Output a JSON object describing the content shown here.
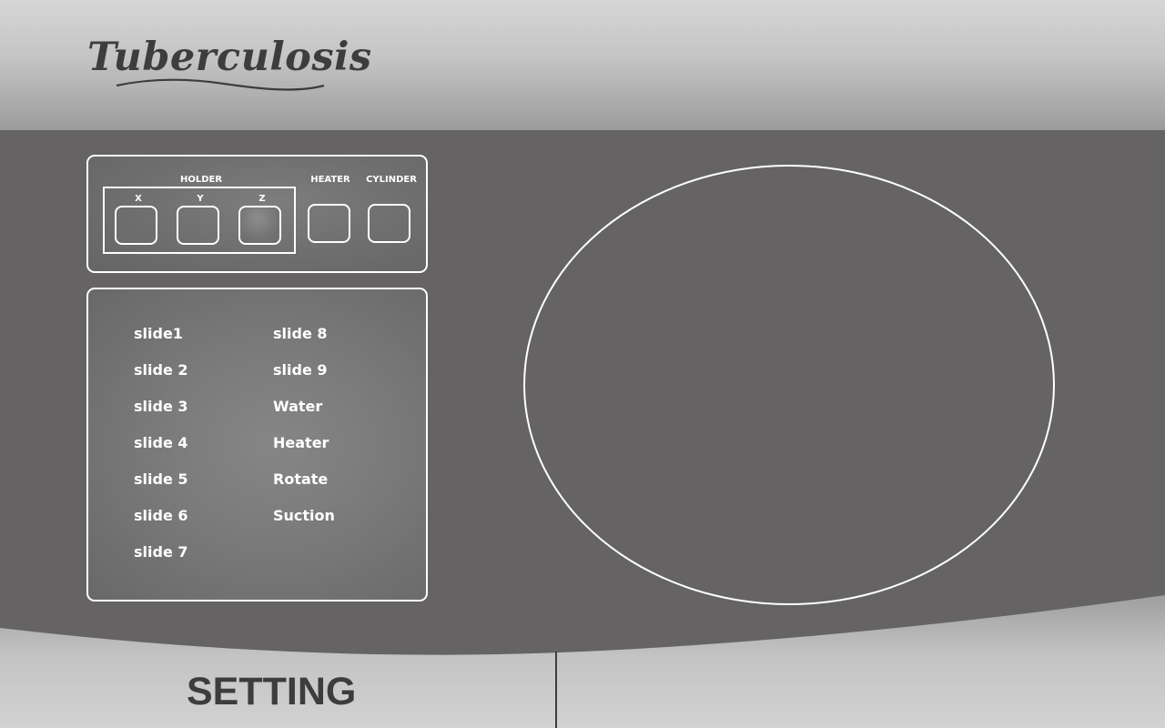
{
  "app": {
    "title": "Tuberculosis"
  },
  "controls": {
    "holder_label": "HOLDER",
    "heater_label": "HEATER",
    "cylinder_label": "CYLINDER",
    "axes": [
      "X",
      "Y",
      "Z"
    ]
  },
  "slides": {
    "left": [
      "slide1",
      "slide 2",
      "slide 3",
      "slide 4",
      "slide 5",
      "slide 6",
      "slide 7"
    ],
    "right": [
      "slide 8",
      "slide 9",
      "Water",
      "Heater",
      "Rotate",
      "Suction"
    ]
  },
  "footer": {
    "setting_label": "SETTING"
  },
  "colors": {
    "background": "#656364",
    "header_light": "#d6d6d6",
    "text_dark": "#3e3d3e",
    "outline": "#ffffff"
  }
}
